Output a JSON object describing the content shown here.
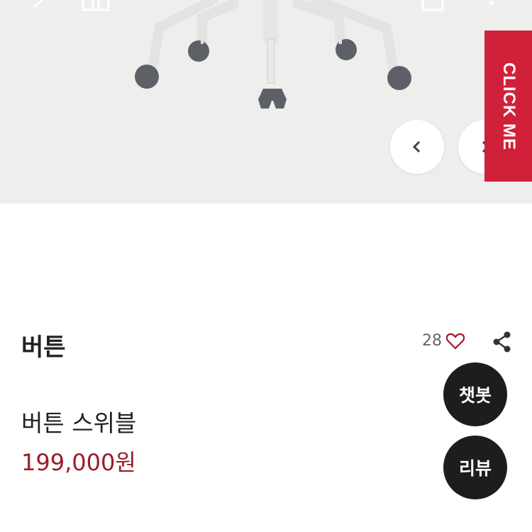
{
  "hero": {
    "banner_label": "CLICK ME",
    "prev_icon": "chevron-left-icon",
    "next_icon": "chevron-right-icon"
  },
  "product": {
    "brand": "버튼",
    "like_count": "28",
    "name": "버튼 스위블",
    "price": "199,000원"
  },
  "floating": {
    "chatbot_label": "챗봇",
    "review_label": "리뷰"
  },
  "colors": {
    "accent_red": "#d1213a",
    "price_red": "#9c1b2b",
    "fab_bg": "#1d1d1d"
  }
}
